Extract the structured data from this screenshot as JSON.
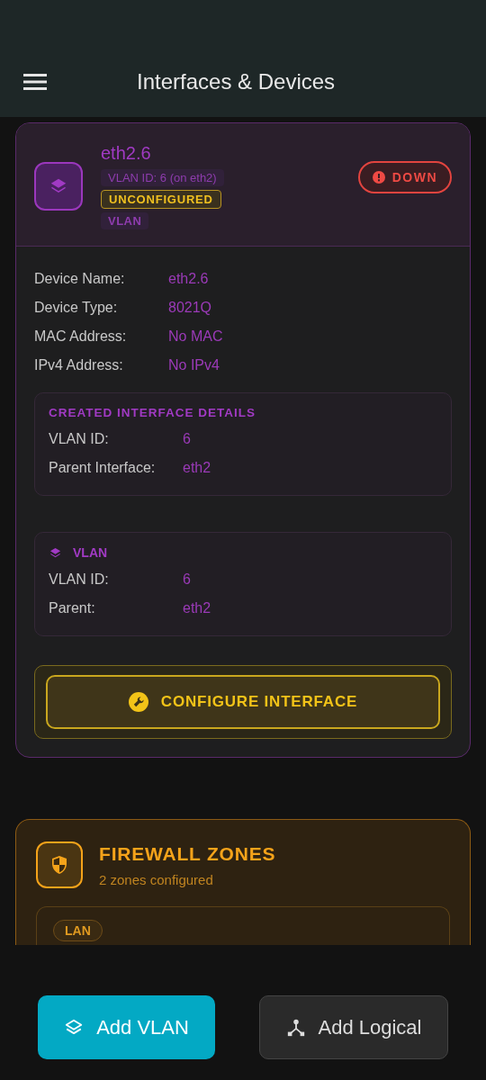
{
  "header": {
    "title": "Interfaces & Devices"
  },
  "device": {
    "name": "eth2.6",
    "status": {
      "kind": "down",
      "label": "DOWN"
    },
    "badges": [
      {
        "kind": "info",
        "label": "VLAN ID: 6 (on eth2)"
      },
      {
        "kind": "warning",
        "label": "UNCONFIGURED"
      },
      {
        "kind": "type",
        "label": "VLAN"
      }
    ],
    "fields": [
      {
        "label": "Device Name:",
        "value": "eth2.6"
      },
      {
        "label": "Device Type:",
        "value": "8021Q"
      },
      {
        "label": "MAC Address:",
        "value": "No MAC"
      },
      {
        "label": "IPv4 Address:",
        "value": "No IPv4"
      }
    ],
    "created_details": {
      "title": "CREATED INTERFACE DETAILS",
      "fields": [
        {
          "label": "VLAN ID:",
          "value": "6"
        },
        {
          "label": "Parent Interface:",
          "value": "eth2"
        }
      ]
    },
    "vlan_section": {
      "title": "VLAN",
      "fields": [
        {
          "label": "VLAN ID:",
          "value": "6"
        },
        {
          "label": "Parent:",
          "value": "eth2"
        }
      ]
    },
    "configure_button": "CONFIGURE INTERFACE"
  },
  "firewall": {
    "title": "FIREWALL ZONES",
    "subtitle": "2 zones configured",
    "zones": [
      {
        "label": "LAN"
      }
    ]
  },
  "bottom_bar": {
    "buttons": [
      {
        "kind": "primary",
        "label": "Add VLAN"
      },
      {
        "kind": "secondary",
        "label": "Add Logical"
      }
    ]
  }
}
